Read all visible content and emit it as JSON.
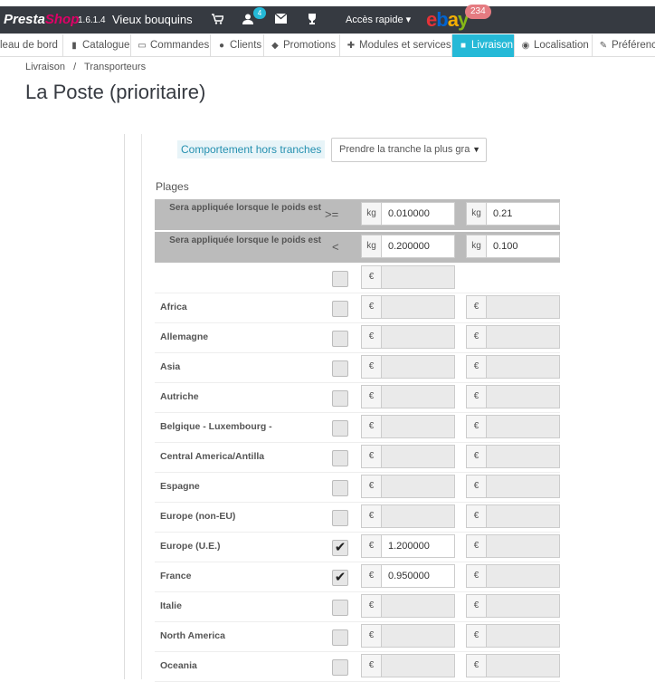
{
  "topbar": {
    "logo_presta": "Presta",
    "logo_shop": "Shop",
    "version": "1.6.1.4",
    "shop_name": "Vieux bouquins",
    "customers_badge": "4",
    "quick_access": "Accès rapide",
    "ebay_badge": "234"
  },
  "menu": [
    {
      "label": "leau de bord",
      "icon": "dashboard-icon"
    },
    {
      "label": "Catalogue",
      "icon": "book-icon"
    },
    {
      "label": "Commandes",
      "icon": "credit-card-icon"
    },
    {
      "label": "Clients",
      "icon": "users-icon"
    },
    {
      "label": "Promotions",
      "icon": "tag-icon"
    },
    {
      "label": "Modules et services",
      "icon": "puzzle-icon"
    },
    {
      "label": "Livraison",
      "icon": "truck-icon"
    },
    {
      "label": "Localisation",
      "icon": "globe-icon"
    },
    {
      "label": "Préférences",
      "icon": "wrench-icon"
    }
  ],
  "breadcrumb": {
    "first": "Livraison",
    "sep": "/",
    "second": "Transporteurs"
  },
  "page_title": "La Poste (prioritaire)",
  "oob": {
    "label": "Comportement hors tranches",
    "value": "Prendre la tranche la plus gra"
  },
  "plages_title": "Plages",
  "range_rows": [
    {
      "label": "Sera appliquée lorsque le poids est",
      "op": ">=",
      "unit": "kg",
      "v1": "0.010000",
      "v2": "0.21"
    },
    {
      "label": "Sera appliquée lorsque le poids est",
      "op": "<",
      "unit": "kg",
      "v1": "0.200000",
      "v2": "0.100"
    }
  ],
  "currency": "€",
  "zones": [
    {
      "name": "Africa",
      "checked": false,
      "price": ""
    },
    {
      "name": "Allemagne",
      "checked": false,
      "price": ""
    },
    {
      "name": "Asia",
      "checked": false,
      "price": ""
    },
    {
      "name": "Autriche",
      "checked": false,
      "price": ""
    },
    {
      "name": "Belgique - Luxembourg -",
      "checked": false,
      "price": ""
    },
    {
      "name": "Central America/Antilla",
      "checked": false,
      "price": ""
    },
    {
      "name": "Espagne",
      "checked": false,
      "price": ""
    },
    {
      "name": "Europe (non-EU)",
      "checked": false,
      "price": ""
    },
    {
      "name": "Europe (U.E.)",
      "checked": true,
      "price": "1.200000"
    },
    {
      "name": "France",
      "checked": true,
      "price": "0.950000"
    },
    {
      "name": "Italie",
      "checked": false,
      "price": ""
    },
    {
      "name": "North America",
      "checked": false,
      "price": ""
    },
    {
      "name": "Oceania",
      "checked": false,
      "price": ""
    }
  ]
}
